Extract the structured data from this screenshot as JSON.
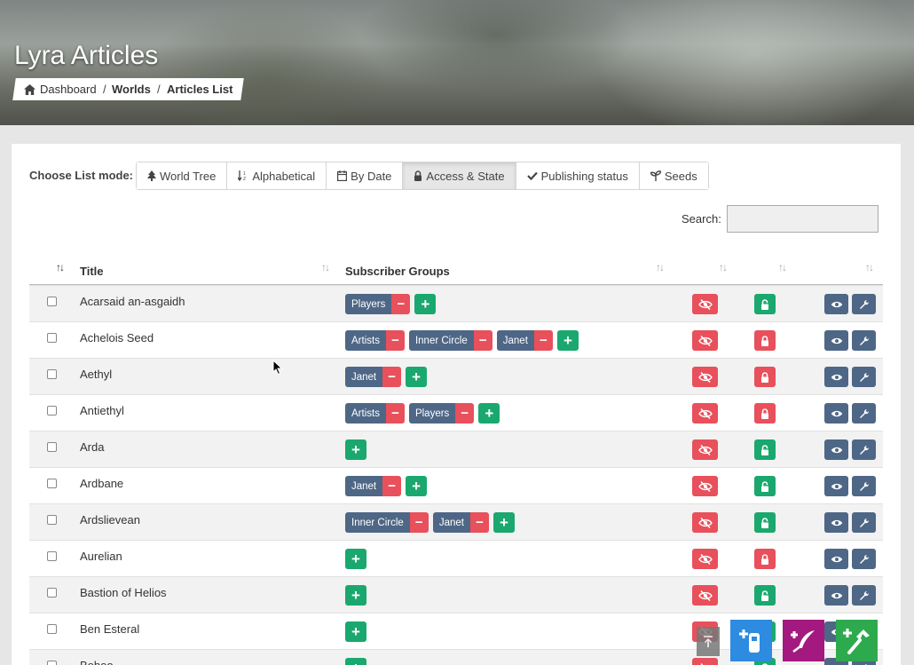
{
  "header": {
    "title": "Lyra Articles",
    "breadcrumb": {
      "home_label": "Dashboard",
      "worlds_label": "Worlds",
      "current_label": "Articles List",
      "separator": "/"
    }
  },
  "list_mode": {
    "label": "Choose List mode:",
    "modes": [
      {
        "label": "World Tree",
        "icon": "tree-icon"
      },
      {
        "label": "Alphabetical",
        "icon": "sort-alpha-icon"
      },
      {
        "label": "By Date",
        "icon": "calendar-icon"
      },
      {
        "label": "Access & State",
        "icon": "lock-icon",
        "active": true
      },
      {
        "label": "Publishing status",
        "icon": "check-icon"
      },
      {
        "label": "Seeds",
        "icon": "seedling-icon"
      }
    ]
  },
  "search": {
    "label": "Search:",
    "value": ""
  },
  "table": {
    "columns": {
      "title": "Title",
      "groups": "Subscriber Groups"
    },
    "rows": [
      {
        "title": "Acarsaid an-asgaidh",
        "groups": [
          "Players"
        ],
        "locked": false
      },
      {
        "title": "Achelois Seed",
        "groups": [
          "Artists",
          "Inner Circle",
          "Janet"
        ],
        "locked": true
      },
      {
        "title": "Aethyl",
        "groups": [
          "Janet"
        ],
        "locked": true
      },
      {
        "title": "Antiethyl",
        "groups": [
          "Artists",
          "Players"
        ],
        "locked": true
      },
      {
        "title": "Arda",
        "groups": [],
        "locked": false
      },
      {
        "title": "Ardbane",
        "groups": [
          "Janet"
        ],
        "locked": false
      },
      {
        "title": "Ardslievean",
        "groups": [
          "Inner Circle",
          "Janet"
        ],
        "locked": false
      },
      {
        "title": "Aurelian",
        "groups": [],
        "locked": true
      },
      {
        "title": "Bastion of Helios",
        "groups": [],
        "locked": false
      },
      {
        "title": "Ben Esteral",
        "groups": [],
        "locked": false
      },
      {
        "title": "Boboo",
        "groups": [],
        "locked": false
      }
    ]
  },
  "colors": {
    "chip": "#4e6786",
    "remove": "#e8505b",
    "add": "#1aa86e",
    "hidden": "#e8505b",
    "unlocked": "#1aa86e",
    "locked": "#e8505b",
    "action": "#4e6786"
  }
}
